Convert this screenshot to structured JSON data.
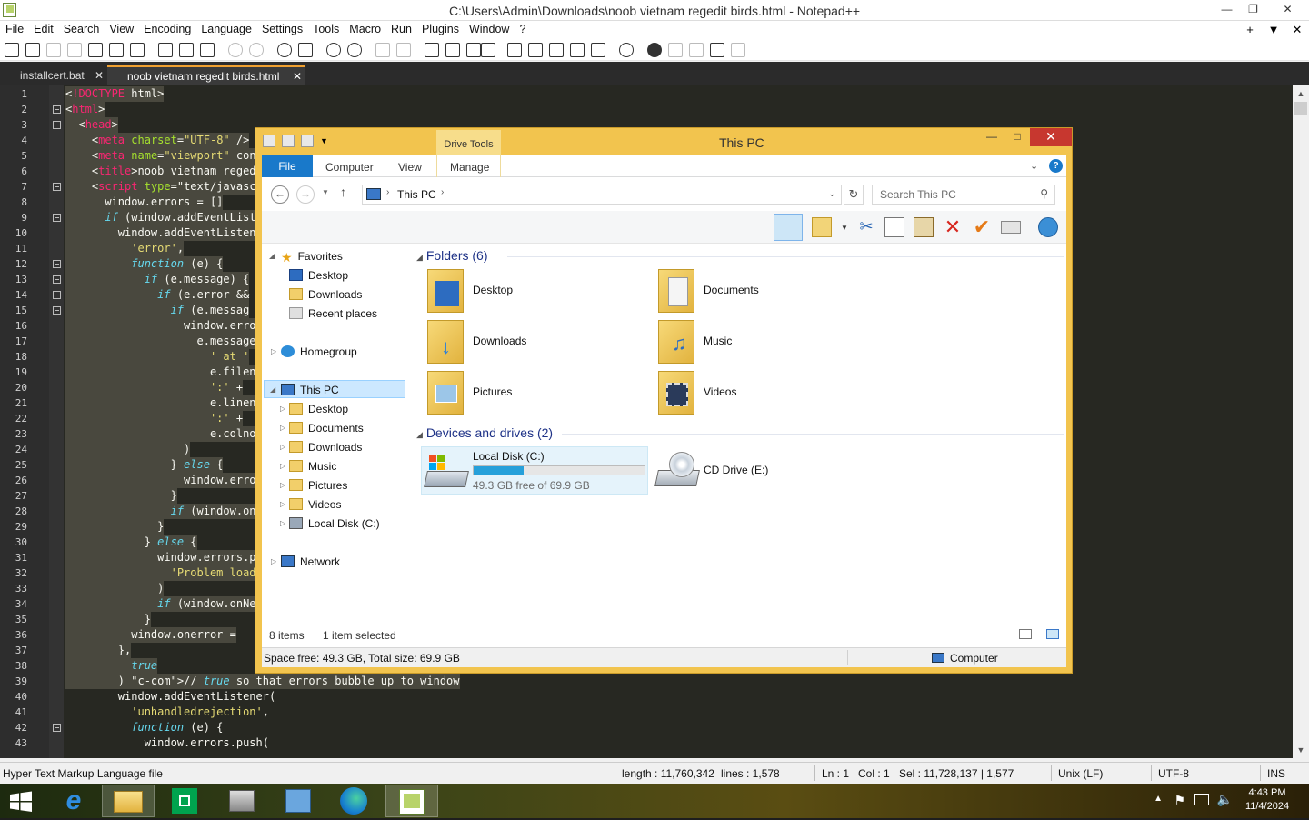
{
  "notepad": {
    "title": "C:\\Users\\Admin\\Downloads\\noob vietnam regedit birds.html - Notepad++",
    "menu": [
      "File",
      "Edit",
      "Search",
      "View",
      "Encoding",
      "Language",
      "Settings",
      "Tools",
      "Macro",
      "Run",
      "Plugins",
      "Window",
      "?"
    ],
    "menu_right": [
      "+",
      "▼",
      "✕"
    ],
    "tabs": [
      {
        "label": "installcert.bat",
        "close": "✕"
      },
      {
        "label": "noob vietnam regedit birds.html",
        "close": "✕"
      }
    ],
    "line_numbers": [
      "1",
      "2",
      "3",
      "4",
      "5",
      "6",
      "7",
      "8",
      "9",
      "10",
      "11",
      "12",
      "13",
      "14",
      "15",
      "16",
      "17",
      "18",
      "19",
      "20",
      "21",
      "22",
      "23",
      "24",
      "25",
      "26",
      "27",
      "28",
      "29",
      "30",
      "31",
      "32",
      "33",
      "34",
      "35",
      "36",
      "37",
      "38",
      "39",
      "40",
      "41",
      "42",
      "43"
    ],
    "code_lines": [
      "<!DOCTYPE html>",
      "<html>",
      "  <head>",
      "    <meta charset=\"UTF-8\" />",
      "    <meta name=\"viewport\" con",
      "    <title>noob vietnam reged",
      "    <script type=\"text/javasc",
      "      window.errors = []",
      "      if (window.addEventList",
      "        window.addEventListen",
      "          'error',",
      "          function (e) {",
      "            if (e.message) {",
      "              if (e.error &&",
      "                if (e.messag",
      "                  window.erro",
      "                    e.message",
      "                      ' at '",
      "                      e.filen",
      "                      ':' +",
      "                      e.linen",
      "                      ':' +",
      "                      e.colno",
      "                  )",
      "                } else {",
      "                  window.erro",
      "                }",
      "                if (window.on",
      "              }",
      "            } else {",
      "              window.errors.p",
      "                'Problem load",
      "              )",
      "              if (window.onNe",
      "            }",
      "          window.onerror =",
      "        },",
      "          true",
      "        ) // true so that errors bubble up to window",
      "        window.addEventListener(",
      "          'unhandledrejection',",
      "          function (e) {",
      "            window.errors.push("
    ],
    "status": {
      "filetype": "Hyper Text Markup Language file",
      "length": "length : 11,760,342",
      "lines": "lines : 1,578",
      "ln": "Ln : 1",
      "col": "Col : 1",
      "sel": "Sel : 11,728,137 | 1,577",
      "eol": "Unix (LF)",
      "encoding": "UTF-8",
      "mode": "INS"
    }
  },
  "explorer": {
    "title": "This PC",
    "contextual_tab": "Drive Tools",
    "ribbon_tabs": [
      "File",
      "Computer",
      "View",
      "Manage"
    ],
    "breadcrumb": "This PC",
    "search_placeholder": "Search This PC",
    "nav": {
      "favorites": "Favorites",
      "fav_items": [
        "Desktop",
        "Downloads",
        "Recent places"
      ],
      "homegroup": "Homegroup",
      "thispc": "This PC",
      "pc_items": [
        "Desktop",
        "Documents",
        "Downloads",
        "Music",
        "Pictures",
        "Videos",
        "Local Disk (C:)"
      ],
      "network": "Network"
    },
    "folders_header": "Folders (6)",
    "folders": [
      "Desktop",
      "Documents",
      "Downloads",
      "Music",
      "Pictures",
      "Videos"
    ],
    "drives_header": "Devices and drives (2)",
    "drive_c": {
      "name": "Local Disk (C:)",
      "free_text": "49.3 GB free of 69.9 GB",
      "used_fraction": 0.295
    },
    "drive_e": {
      "name": "CD Drive (E:)"
    },
    "status_items": "8 items",
    "status_selected": "1 item selected",
    "footer_space": "Space free: 49.3 GB, Total size: 69.9 GB",
    "footer_computer": "Computer"
  },
  "taskbar": {
    "time": "4:43 PM",
    "date": "11/4/2024"
  }
}
